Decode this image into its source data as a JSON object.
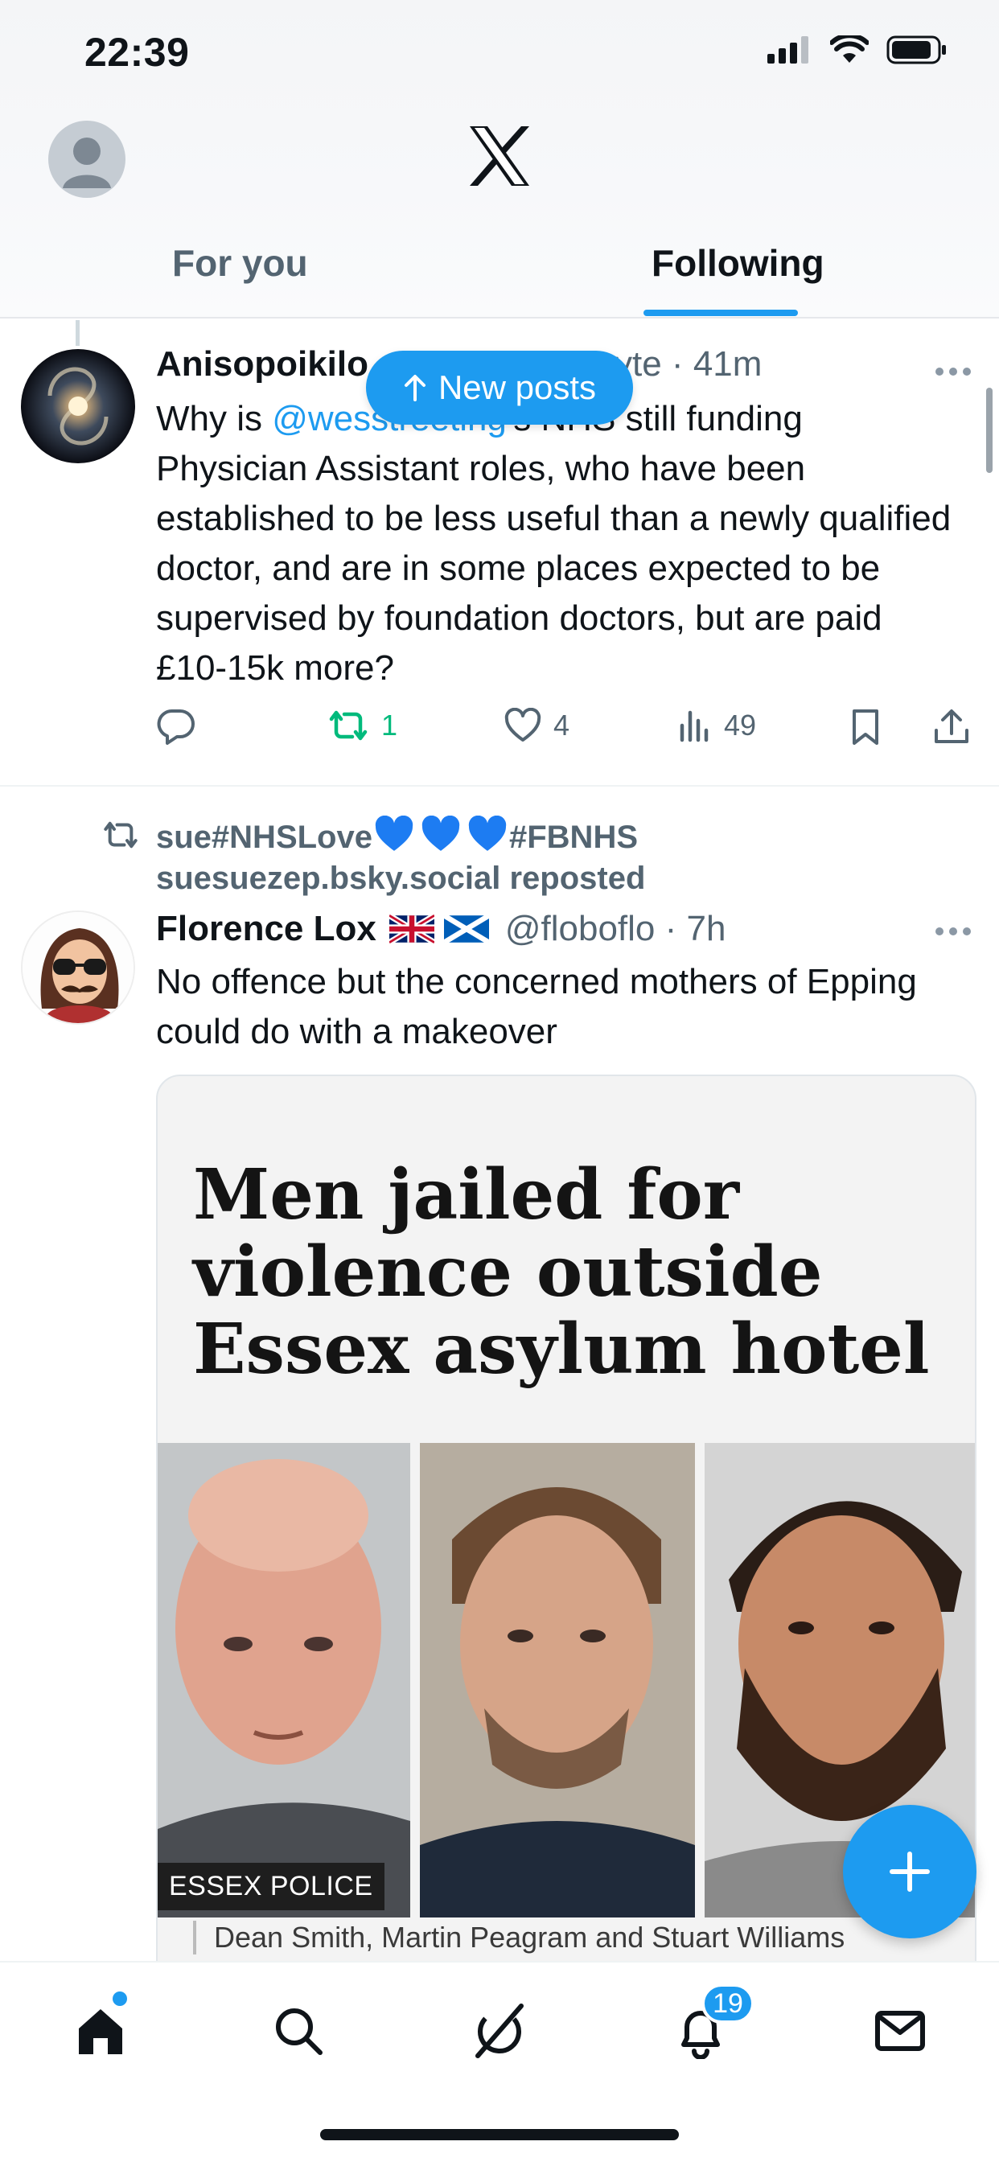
{
  "status_bar": {
    "time": "22:39"
  },
  "header": {
    "tabs": [
      {
        "label": "For you",
        "selected": false
      },
      {
        "label": "Following",
        "selected": true
      }
    ]
  },
  "new_posts_pill": {
    "label": "New posts"
  },
  "posts": [
    {
      "author_name": "Anisopoikilo",
      "author_handle_tail": "yte",
      "time": "41m",
      "text_before_mention": "Why is ",
      "mention": "@wesstreeting",
      "text_after_mention": "'s NHS still funding Physician Assistant roles, who have been established to be less useful than a newly qualified doctor, and are in some places expected to be supervised by foundation doctors, but are paid £10-15k more?",
      "stats": {
        "replies": "",
        "reposts": "1",
        "likes": "4",
        "views": "49"
      }
    },
    {
      "reposted_by_line1": "sue#NHSLove",
      "reposted_by_line1_tail": "#FBNHS",
      "reposted_by_line2": "suesuezep.bsky.social reposted",
      "author_name": "Florence Lox",
      "author_flags": "🇬🇧 🏴",
      "author_handle": "@floboflo",
      "time": "7h",
      "text": "No offence but the concerned mothers of Epping could do with a makeover",
      "card": {
        "headline": "Men jailed for violence outside Essex asylum hotel",
        "image_tag": "ESSEX POLICE",
        "caption": "Dean Smith, Martin Peagram and Stuart Williams"
      }
    }
  ],
  "tabbar": {
    "items": [
      "home",
      "search",
      "grok",
      "notifications",
      "messages"
    ],
    "notification_count": "19"
  },
  "colors": {
    "accent": "#1d9bf0",
    "repost_green": "#00ba7c",
    "muted": "#536471"
  }
}
